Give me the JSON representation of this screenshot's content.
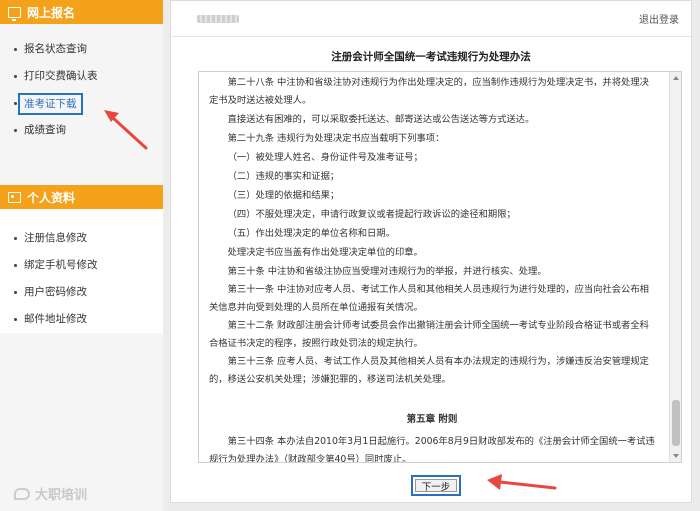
{
  "sidebar": {
    "section1_title": "网上报名",
    "section1_items": [
      {
        "label": "报名状态查询"
      },
      {
        "label": "打印交费确认表"
      },
      {
        "label": "准考证下载"
      },
      {
        "label": "成绩查询"
      }
    ],
    "section2_title": "个人资料",
    "section2_items": [
      {
        "label": "注册信息修改"
      },
      {
        "label": "绑定手机号修改"
      },
      {
        "label": "用户密码修改"
      },
      {
        "label": "邮件地址修改"
      }
    ]
  },
  "header": {
    "logout": "退出登录"
  },
  "document": {
    "title": "注册会计师全国统一考试违规行为处理办法",
    "paragraphs": [
      "第二十八条 中注协和省级注协对违规行为作出处理决定的，应当制作违规行为处理决定书，并将处理决定书及时送达被处理人。",
      "直接送达有困难的，可以采取委托送达、邮寄送达或公告送达等方式送达。",
      "第二十九条 违规行为处理决定书应当载明下列事项：",
      "（一）被处理人姓名、身份证件号及准考证号；",
      "（二）违规的事实和证据；",
      "（三）处理的依据和结果；",
      "（四）不服处理决定，申请行政复议或者提起行政诉讼的途径和期限；",
      "（五）作出处理决定的单位名称和日期。",
      "处理决定书应当盖有作出处理决定单位的印章。",
      "第三十条 中注协和省级注协应当受理对违规行为的举报，并进行核实、处理。",
      "第三十一条 中注协对应考人员、考试工作人员和其他相关人员违规行为进行处理的，应当向社会公布相关信息并向受到处理的人员所在单位通报有关情况。",
      "第三十二条 财政部注册会计师考试委员会作出撤销注册会计师全国统一考试专业阶段合格证书或者全科合格证书决定的程序，按照行政处罚法的规定执行。",
      "第三十三条 应考人员、考试工作人员及其他相关人员有本办法规定的违规行为，涉嫌违反治安管理规定的，移送公安机关处理；涉嫌犯罪的，移送司法机关处理。"
    ],
    "chapter": "第五章 附则",
    "final_paragraph": "第三十四条 本办法自2010年3月1日起施行。2006年8月9日财政部发布的《注册会计师全国统一考试违规行为处理办法》（财政部令第40号）同时废止。"
  },
  "next_button": "下一步",
  "watermark": "大职培训",
  "colors": {
    "sidebar_header": "#f5a21b",
    "highlight_blue": "#2a6fc0",
    "arrow_red": "#e8473f"
  }
}
